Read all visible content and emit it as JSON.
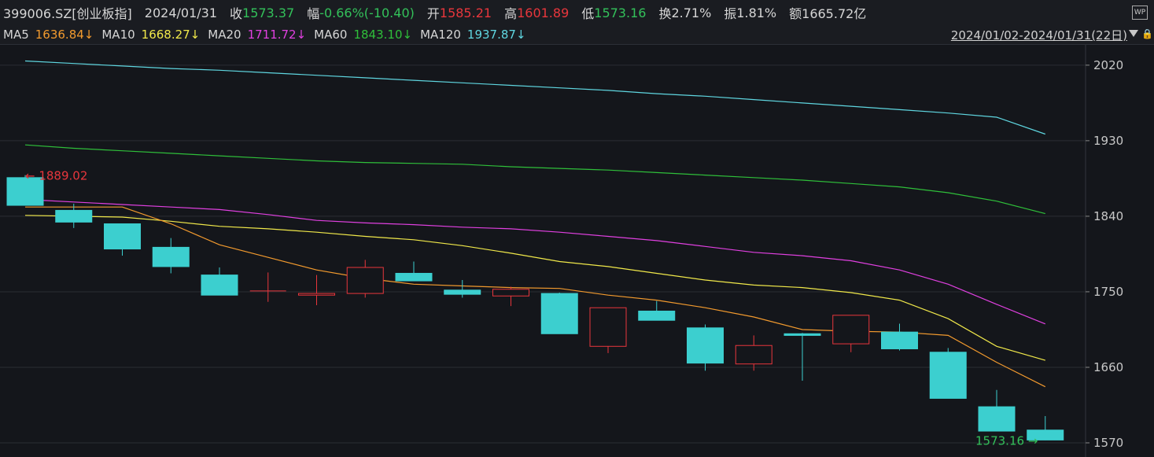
{
  "header": {
    "code": "399006.SZ[创业板指]",
    "date": "2024/01/31",
    "close_label": "收",
    "close_value": "1573.37",
    "change_label": "幅",
    "change_value": "-0.66%(-10.40)",
    "open_label": "开",
    "open_value": "1585.21",
    "high_label": "高",
    "high_value": "1601.89",
    "low_label": "低",
    "low_value": "1573.16",
    "turnover_label": "换",
    "turnover_value": "2.71%",
    "amplitude_label": "振",
    "amplitude_value": "1.81%",
    "amount_label": "额",
    "amount_value": "1665.72亿",
    "wp_icon": "WP"
  },
  "indicators": {
    "ma5_label": "MA5",
    "ma5_value": "1636.84↓",
    "ma10_label": "MA10",
    "ma10_value": "1668.27↓",
    "ma20_label": "MA20",
    "ma20_value": "1711.72↓",
    "ma60_label": "MA60",
    "ma60_value": "1843.10↓",
    "ma120_label": "MA120",
    "ma120_value": "1937.87↓",
    "range": "2024/01/02-2024/01/31(22日)"
  },
  "colors": {
    "up": "#e8363c",
    "down": "#3ccfcf",
    "ma5": "#f29a2e",
    "ma10": "#f0e84a",
    "ma20": "#e040e0",
    "ma60": "#2fbf3a",
    "ma120": "#5fd6e0"
  },
  "chart_data": {
    "type": "candlestick",
    "yticks": [
      1570,
      1660,
      1750,
      1840,
      1930,
      2020
    ],
    "ylim": [
      1563,
      2043
    ],
    "annotations": {
      "high": "1889.02",
      "low": "1573.16"
    },
    "candles": [
      {
        "o": 1886,
        "c": 1853,
        "h": 1889.02,
        "l": 1853
      },
      {
        "o": 1847,
        "c": 1833,
        "h": 1855,
        "l": 1826
      },
      {
        "o": 1831,
        "c": 1801,
        "h": 1831,
        "l": 1793
      },
      {
        "o": 1803,
        "c": 1780,
        "h": 1814,
        "l": 1772
      },
      {
        "o": 1770,
        "c": 1746,
        "h": 1779,
        "l": 1746
      },
      {
        "o": 1751,
        "c": 1751,
        "h": 1773,
        "l": 1738
      },
      {
        "o": 1746,
        "c": 1748,
        "h": 1770,
        "l": 1734
      },
      {
        "o": 1748,
        "c": 1779,
        "h": 1788,
        "l": 1743
      },
      {
        "o": 1772,
        "c": 1763,
        "h": 1786,
        "l": 1763
      },
      {
        "o": 1752,
        "c": 1747,
        "h": 1764,
        "l": 1743
      },
      {
        "o": 1745,
        "c": 1753,
        "h": 1756,
        "l": 1733
      },
      {
        "o": 1748,
        "c": 1700,
        "h": 1749,
        "l": 1700
      },
      {
        "o": 1685,
        "c": 1731,
        "h": 1731,
        "l": 1677
      },
      {
        "o": 1727,
        "c": 1716,
        "h": 1739,
        "l": 1716
      },
      {
        "o": 1707,
        "c": 1665,
        "h": 1711,
        "l": 1656
      },
      {
        "o": 1664,
        "c": 1686,
        "h": 1698,
        "l": 1656
      },
      {
        "o": 1700,
        "c": 1698,
        "h": 1701,
        "l": 1644
      },
      {
        "o": 1688,
        "c": 1722,
        "h": 1722,
        "l": 1678
      },
      {
        "o": 1702,
        "c": 1682,
        "h": 1712,
        "l": 1680
      },
      {
        "o": 1678,
        "c": 1623,
        "h": 1683,
        "l": 1623
      },
      {
        "o": 1613,
        "c": 1584,
        "h": 1633,
        "l": 1584
      },
      {
        "o": 1585.21,
        "c": 1573.37,
        "h": 1601.89,
        "l": 1573.16
      }
    ],
    "ma5": [
      1851,
      1851,
      1851,
      1831,
      1806,
      1791,
      1776,
      1766,
      1759,
      1757,
      1755,
      1754,
      1746,
      1740,
      1731,
      1720,
      1705,
      1703,
      1702,
      1698,
      1666,
      1636.84
    ],
    "ma10": [
      1841,
      1840,
      1839,
      1834,
      1828,
      1825,
      1821,
      1816,
      1812,
      1805,
      1796,
      1786,
      1780,
      1772,
      1764,
      1758,
      1755,
      1749,
      1740,
      1718,
      1685,
      1668.27
    ],
    "ma20": [
      1860,
      1857,
      1854,
      1851,
      1848,
      1842,
      1835,
      1832,
      1830,
      1827,
      1825,
      1821,
      1816,
      1811,
      1804,
      1797,
      1793,
      1787,
      1776,
      1759,
      1735,
      1711.72
    ],
    "ma60": [
      1925,
      1921,
      1918,
      1915,
      1912,
      1909,
      1906,
      1904,
      1903,
      1902,
      1899,
      1897,
      1895,
      1892,
      1889,
      1886,
      1883,
      1879,
      1875,
      1868,
      1858,
      1843.1
    ],
    "ma120": [
      2025,
      2022,
      2019,
      2016,
      2014,
      2011,
      2008,
      2005,
      2002,
      1999,
      1996,
      1993,
      1990,
      1986,
      1983,
      1979,
      1975,
      1971,
      1967,
      1963,
      1958,
      1937.87
    ]
  }
}
